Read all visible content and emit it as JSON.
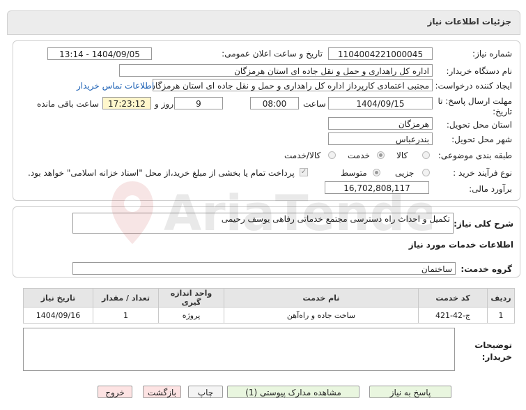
{
  "header": {
    "title": "جزئیات اطلاعات نیاز"
  },
  "fields": {
    "need_number_label": "شماره نیاز:",
    "need_number": "1104004221000045",
    "announce_label": "تاریخ و ساعت اعلان عمومی:",
    "announce_value": "1404/09/05 - 13:14",
    "buyer_org_label": "نام دستگاه خریدار:",
    "buyer_org": "اداره کل راهداری و حمل و نقل جاده ای استان هرمزگان",
    "creator_label": "ایجاد کننده درخواست:",
    "creator": "مجتبی اعتمادی کارپرداز اداره کل راهداری و حمل و نقل جاده ای استان هرمزگان",
    "contact_link": "اطلاعات تماس خریدار",
    "deadline_label_1": "مهلت ارسال پاسخ: تا",
    "deadline_label_2": "تاریخ:",
    "deadline_date": "1404/09/15",
    "time_label": "ساعت",
    "deadline_time": "08:00",
    "days": "9",
    "days_label": "روز و",
    "remaining_time": "17:23:12",
    "remaining_label": "ساعت باقی مانده",
    "province_label": "استان محل تحویل:",
    "province": "هرمزگان",
    "city_label": "شهر محل تحویل:",
    "city": "بندرعباس",
    "category_label": "طبقه بندی موضوعی:",
    "category_options": [
      "کالا",
      "خدمت",
      "کالا/خدمت"
    ],
    "category_selected": 1,
    "process_label": "نوع فرآیند خرید :",
    "process_options": [
      "جزیی",
      "متوسط"
    ],
    "process_selected": 1,
    "payment_note": "پرداخت تمام یا بخشی از مبلغ خرید،از محل \"اسناد خزانه اسلامی\" خواهد بود.",
    "estimate_label": "برآورد مالی:",
    "estimate": "16,702,808,117"
  },
  "summary": {
    "label": "شرح کلی نیاز:",
    "text": "تکمیل و احداث راه دسترسی مجتمع خدماتی رفاهی یوسف رحیمی"
  },
  "services": {
    "section_title": "اطلاعات خدمات مورد نیاز",
    "group_label": "گروه خدمت:",
    "group_value": "ساختمان",
    "columns": [
      "ردیف",
      "کد خدمت",
      "نام خدمت",
      "واحد اندازه گیری",
      "تعداد / مقدار",
      "تاریخ نیاز"
    ],
    "rows": [
      [
        "1",
        "ج-42-421",
        "ساخت جاده و راه‌آهن",
        "پروژه",
        "1",
        "1404/09/16"
      ]
    ]
  },
  "buyer_notes": {
    "label_1": "توضیحات",
    "label_2": "خریدار:",
    "value": ""
  },
  "buttons": {
    "reply": "پاسخ به نیاز",
    "attachments": "مشاهده مدارک پیوستی (1)",
    "print": "چاپ",
    "back": "بازگشت",
    "exit": "خروج"
  },
  "watermark": "AriaTender.neT"
}
